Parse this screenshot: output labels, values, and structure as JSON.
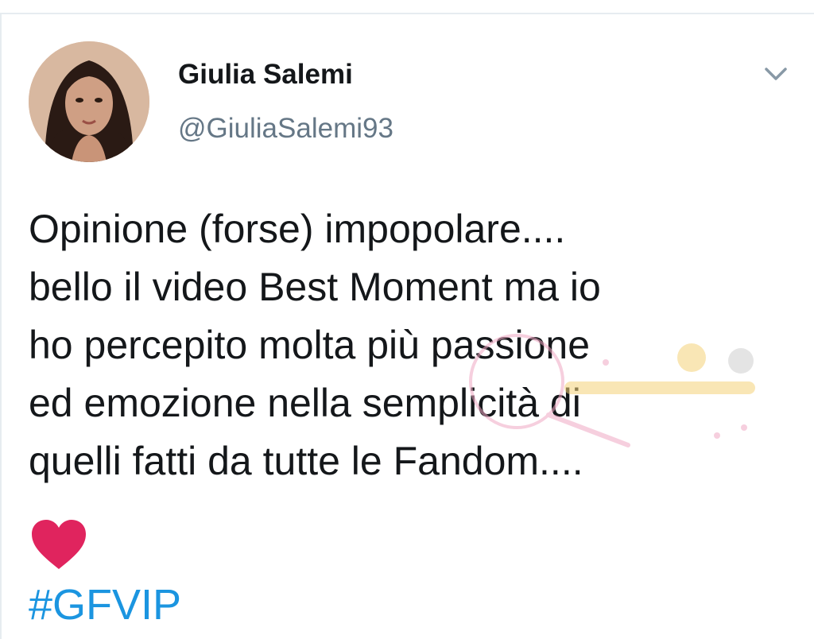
{
  "tweet": {
    "author": {
      "display_name": "Giulia Salemi",
      "handle": "@GiuliaSalemi93",
      "avatar_icon": "profile-photo"
    },
    "menu_icon": "chevron-down-icon",
    "text_lines": [
      "Opinione (forse) impopolare....",
      "bello il video Best Moment ma io",
      "ho percepito molta più passione",
      "ed emozione nella semplicità di",
      "quelli fatti da tutte le Fandom...."
    ],
    "emoji": "red-heart",
    "hashtag": "#GFVIP"
  },
  "colors": {
    "text": "#14171a",
    "secondary_text": "#657786",
    "link": "#1b95e0",
    "heart": "#e0245e",
    "divider": "#e6ecf0"
  }
}
